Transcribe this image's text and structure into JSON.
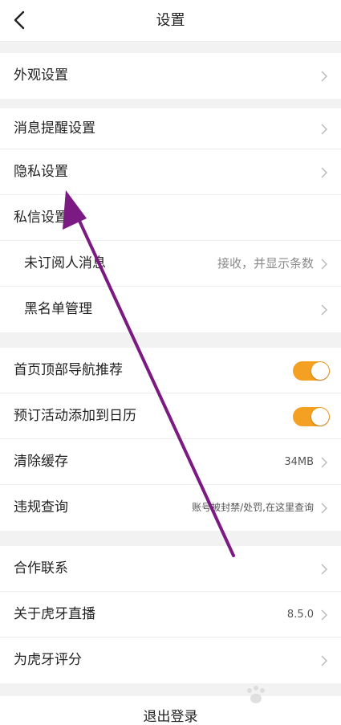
{
  "header": {
    "title": "设置",
    "back_icon": "chevron-left-icon"
  },
  "section1": [
    {
      "label": "外观设置"
    }
  ],
  "section2": [
    {
      "label": "消息提醒设置"
    },
    {
      "label": "隐私设置"
    },
    {
      "label": "私信设置"
    },
    {
      "label": "未订阅人消息",
      "value": "接收，并显示条数"
    },
    {
      "label": "黑名单管理"
    }
  ],
  "section3": [
    {
      "label": "首页顶部导航推荐",
      "toggle": true
    },
    {
      "label": "预订活动添加到日历",
      "toggle": true
    },
    {
      "label": "清除缓存",
      "value": "34MB"
    },
    {
      "label": "违规查询",
      "value": "账号被封禁/处罚,在这里查询"
    }
  ],
  "section4": [
    {
      "label": "合作联系"
    },
    {
      "label": "关于虎牙直播",
      "value": "8.5.0"
    },
    {
      "label": "为虎牙评分"
    }
  ],
  "logout": {
    "label": "退出登录"
  },
  "colors": {
    "toggle_on": "#f3a023",
    "annotation_arrow": "#7a1a82",
    "background": "#f2f2f2"
  }
}
